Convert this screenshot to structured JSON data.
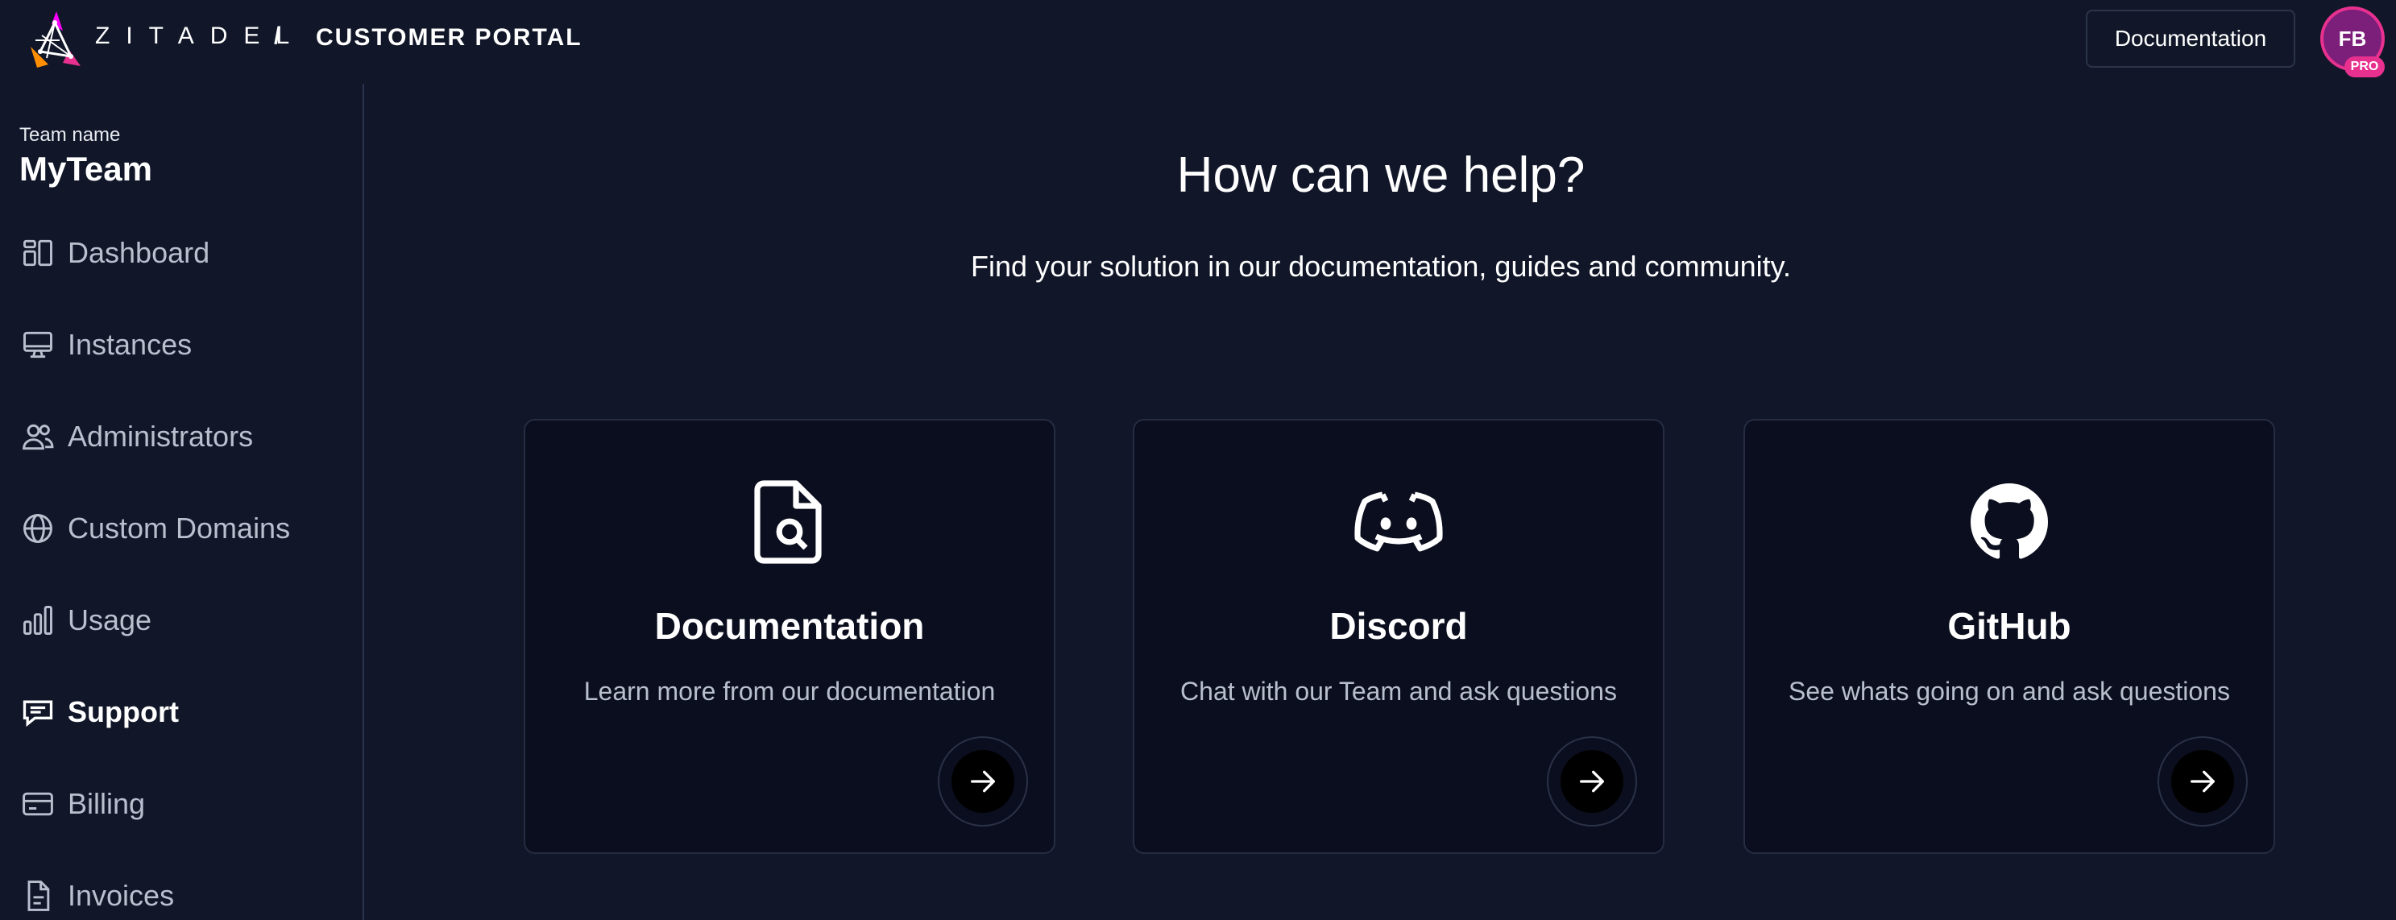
{
  "header": {
    "wordmark": "ZITADEL",
    "separator": "/",
    "portal_title": "CUSTOMER PORTAL",
    "documentation_button": "Documentation",
    "avatar_initials": "FB",
    "plan_badge": "PRO"
  },
  "sidebar": {
    "team_label": "Team name",
    "team_name": "MyTeam",
    "items": [
      {
        "label": "Dashboard",
        "icon": "dashboard-icon"
      },
      {
        "label": "Instances",
        "icon": "monitor-icon"
      },
      {
        "label": "Administrators",
        "icon": "users-icon"
      },
      {
        "label": "Custom Domains",
        "icon": "globe-icon"
      },
      {
        "label": "Usage",
        "icon": "bar-chart-icon"
      },
      {
        "label": "Support",
        "icon": "chat-icon",
        "active": true
      },
      {
        "label": "Billing",
        "icon": "credit-card-icon"
      },
      {
        "label": "Invoices",
        "icon": "file-icon"
      }
    ]
  },
  "main": {
    "title": "How can we help?",
    "subtitle": "Find your solution in our documentation, guides and community.",
    "cards": [
      {
        "title": "Documentation",
        "description": "Learn more from our documentation",
        "icon": "document-search-icon"
      },
      {
        "title": "Discord",
        "description": "Chat with our Team and ask questions",
        "icon": "discord-icon"
      },
      {
        "title": "GitHub",
        "description": "See whats going on and ask questions",
        "icon": "github-icon"
      }
    ]
  },
  "colors": {
    "background": "#111729",
    "card_background": "#0b0e1e",
    "accent_pink": "#e8318f",
    "muted_text": "#b8bfcd"
  }
}
